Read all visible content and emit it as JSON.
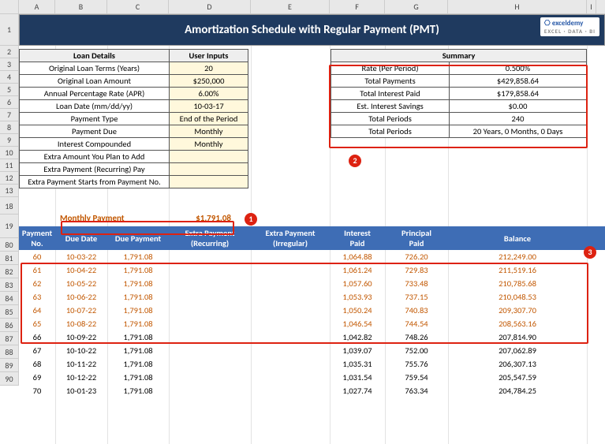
{
  "columns": [
    "A",
    "B",
    "C",
    "D",
    "E",
    "F",
    "G",
    "H",
    "I"
  ],
  "row_labels_top": [
    "1",
    "2",
    "3",
    "4",
    "5",
    "6",
    "7",
    "8",
    "9",
    "10",
    "11",
    "12",
    "13",
    "",
    "18",
    "19"
  ],
  "row_labels_bot": [
    "80",
    "81",
    "82",
    "83",
    "84",
    "85",
    "86",
    "87",
    "88",
    "89",
    "90"
  ],
  "title": "Amortization Schedule with Regular Payment (PMT)",
  "logo": {
    "name": "exceldemy",
    "sub": "EXCEL · DATA · BI"
  },
  "loan": {
    "hdr_details": "Loan Details",
    "hdr_inputs": "User Inputs",
    "rows": [
      {
        "label": "Original Loan Terms (Years)",
        "val": "20"
      },
      {
        "label": "Original Loan Amount",
        "val": "$250,000"
      },
      {
        "label": "Annual Percentage Rate (APR)",
        "val": "6.00%"
      },
      {
        "label": "Loan Date (mm/dd/yy)",
        "val": "10-03-17"
      },
      {
        "label": "Payment Type",
        "val": "End of the Period"
      },
      {
        "label": "Payment Due",
        "val": "Monthly"
      },
      {
        "label": "Interest Compounded",
        "val": "Monthly"
      },
      {
        "label": "Extra Amount You Plan to Add",
        "val": ""
      },
      {
        "label": "Extra Payment (Recurring) Pay",
        "val": ""
      },
      {
        "label": "Extra Payment Starts from Payment No.",
        "val": ""
      }
    ]
  },
  "summary": {
    "hdr": "Summary",
    "rows": [
      {
        "label": "Rate (Per Period)",
        "val": "0.500%"
      },
      {
        "label": "Total Payments",
        "val": "$429,858.64"
      },
      {
        "label": "Total Interest Paid",
        "val": "$179,858.64"
      },
      {
        "label": "Est. Interest Savings",
        "val": "$0.00"
      },
      {
        "label": "Total Periods",
        "val": "240"
      },
      {
        "label": "Total Periods",
        "val": "20 Years, 0 Months, 0 Days"
      }
    ]
  },
  "monthly": {
    "label": "Monthly Payment",
    "value": "$1,791.08"
  },
  "callouts": {
    "c1": "1",
    "c2": "2",
    "c3": "3"
  },
  "sched_hdr": {
    "no": "Payment\nNo.",
    "due": "Due Date",
    "pay": "Due Payment",
    "extraR": "Extra Payment\n(Recurring)",
    "extraI": "Extra Payment\n(Irregular)",
    "int": "Interest\nPaid",
    "prin": "Principal\nPaid",
    "bal": "Balance"
  },
  "sched_rows": [
    {
      "hl": true,
      "no": "60",
      "due": "10-03-22",
      "pay": "1,791.08",
      "er": "",
      "ei": "",
      "int": "1,064.88",
      "prin": "726.20",
      "bal": "212,249.00"
    },
    {
      "hl": true,
      "no": "61",
      "due": "10-04-22",
      "pay": "1,791.08",
      "er": "",
      "ei": "",
      "int": "1,061.24",
      "prin": "729.83",
      "bal": "211,519.16"
    },
    {
      "hl": true,
      "no": "62",
      "due": "10-05-22",
      "pay": "1,791.08",
      "er": "",
      "ei": "",
      "int": "1,057.60",
      "prin": "733.48",
      "bal": "210,785.68"
    },
    {
      "hl": true,
      "no": "63",
      "due": "10-06-22",
      "pay": "1,791.08",
      "er": "",
      "ei": "",
      "int": "1,053.93",
      "prin": "737.15",
      "bal": "210,048.53"
    },
    {
      "hl": true,
      "no": "64",
      "due": "10-07-22",
      "pay": "1,791.08",
      "er": "",
      "ei": "",
      "int": "1,050.24",
      "prin": "740.83",
      "bal": "209,307.70"
    },
    {
      "hl": true,
      "no": "65",
      "due": "10-08-22",
      "pay": "1,791.08",
      "er": "",
      "ei": "",
      "int": "1,046.54",
      "prin": "744.54",
      "bal": "208,563.16"
    },
    {
      "hl": false,
      "no": "66",
      "due": "10-09-22",
      "pay": "1,791.08",
      "er": "",
      "ei": "",
      "int": "1,042.82",
      "prin": "748.26",
      "bal": "207,814.90"
    },
    {
      "hl": false,
      "no": "67",
      "due": "10-10-22",
      "pay": "1,791.08",
      "er": "",
      "ei": "",
      "int": "1,039.07",
      "prin": "752.00",
      "bal": "207,062.89"
    },
    {
      "hl": false,
      "no": "68",
      "due": "10-11-22",
      "pay": "1,791.08",
      "er": "",
      "ei": "",
      "int": "1,035.31",
      "prin": "755.76",
      "bal": "206,307.13"
    },
    {
      "hl": false,
      "no": "69",
      "due": "10-12-22",
      "pay": "1,791.08",
      "er": "",
      "ei": "",
      "int": "1,031.54",
      "prin": "759.54",
      "bal": "205,547.59"
    },
    {
      "hl": false,
      "no": "70",
      "due": "10-01-23",
      "pay": "1,791.08",
      "er": "",
      "ei": "",
      "int": "1,027.74",
      "prin": "763.34",
      "bal": "204,784.25"
    }
  ],
  "chart_data": {
    "type": "table",
    "title": "Amortization Schedule with Regular Payment (PMT)",
    "columns": [
      "Payment No.",
      "Due Date",
      "Due Payment",
      "Extra Payment (Recurring)",
      "Extra Payment (Irregular)",
      "Interest Paid",
      "Principal Paid",
      "Balance"
    ],
    "rows": [
      [
        60,
        "10-03-22",
        1791.08,
        null,
        null,
        1064.88,
        726.2,
        212249.0
      ],
      [
        61,
        "10-04-22",
        1791.08,
        null,
        null,
        1061.24,
        729.83,
        211519.16
      ],
      [
        62,
        "10-05-22",
        1791.08,
        null,
        null,
        1057.6,
        733.48,
        210785.68
      ],
      [
        63,
        "10-06-22",
        1791.08,
        null,
        null,
        1053.93,
        737.15,
        210048.53
      ],
      [
        64,
        "10-07-22",
        1791.08,
        null,
        null,
        1050.24,
        740.83,
        209307.7
      ],
      [
        65,
        "10-08-22",
        1791.08,
        null,
        null,
        1046.54,
        744.54,
        208563.16
      ],
      [
        66,
        "10-09-22",
        1791.08,
        null,
        null,
        1042.82,
        748.26,
        207814.9
      ],
      [
        67,
        "10-10-22",
        1791.08,
        null,
        null,
        1039.07,
        752.0,
        207062.89
      ],
      [
        68,
        "10-11-22",
        1791.08,
        null,
        null,
        1035.31,
        755.76,
        206307.13
      ],
      [
        69,
        "10-12-22",
        1791.08,
        null,
        null,
        1031.54,
        759.54,
        205547.59
      ],
      [
        70,
        "10-01-23",
        1791.08,
        null,
        null,
        1027.74,
        763.34,
        204784.25
      ]
    ]
  }
}
